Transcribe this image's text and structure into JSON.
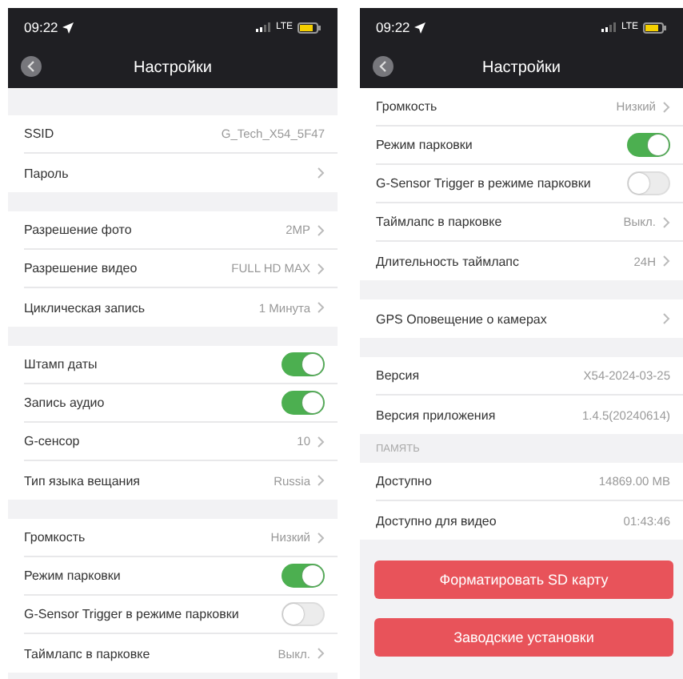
{
  "screens": [
    {
      "status": {
        "time": "09:22",
        "network": "LTE"
      },
      "title": "Настройки",
      "top_gap": true,
      "sections": [
        {
          "rows": [
            {
              "kind": "value",
              "label": "SSID",
              "value": "G_Tech_X54_5F47",
              "chevron": false
            },
            {
              "kind": "value",
              "label": "Пароль",
              "chevron": true
            }
          ]
        },
        {
          "rows": [
            {
              "kind": "value",
              "label": "Разрешение фото",
              "value": "2MP",
              "chevron": true
            },
            {
              "kind": "value",
              "label": "Разрешение видео",
              "value": "FULL HD MAX",
              "chevron": true
            },
            {
              "kind": "value",
              "label": "Циклическая запись",
              "value": "1 Минута",
              "chevron": true
            }
          ]
        },
        {
          "rows": [
            {
              "kind": "toggle",
              "label": "Штамп даты",
              "on": true
            },
            {
              "kind": "toggle",
              "label": "Запись аудио",
              "on": true
            },
            {
              "kind": "value",
              "label": "G-сенсор",
              "value": "10",
              "chevron": true
            },
            {
              "kind": "value",
              "label": "Тип языка вещания",
              "value": "Russia",
              "chevron": true
            }
          ]
        },
        {
          "rows": [
            {
              "kind": "value",
              "label": "Громкость",
              "value": "Низкий",
              "chevron": true
            },
            {
              "kind": "toggle",
              "label": "Режим парковки",
              "on": true
            },
            {
              "kind": "toggle",
              "label": "G-Sensor Trigger в режиме парковки",
              "on": false
            },
            {
              "kind": "value",
              "label": "Таймлапс в парковке",
              "value": "Выкл.",
              "chevron": true
            }
          ]
        }
      ]
    },
    {
      "status": {
        "time": "09:22",
        "network": "LTE"
      },
      "title": "Настройки",
      "top_gap": false,
      "sections": [
        {
          "rows": [
            {
              "kind": "value",
              "label": "Громкость",
              "value": "Низкий",
              "chevron": true
            },
            {
              "kind": "toggle",
              "label": "Режим парковки",
              "on": true
            },
            {
              "kind": "toggle",
              "label": "G-Sensor Trigger в режиме парковки",
              "on": false
            },
            {
              "kind": "value",
              "label": "Таймлапс в парковке",
              "value": "Выкл.",
              "chevron": true
            },
            {
              "kind": "value",
              "label": "Длительность таймлапс",
              "value": "24H",
              "chevron": true
            }
          ]
        },
        {
          "rows": [
            {
              "kind": "value",
              "label": "GPS Оповещение о камерах",
              "chevron": true
            }
          ]
        },
        {
          "rows": [
            {
              "kind": "value",
              "label": "Версия",
              "value": "X54-2024-03-25",
              "chevron": false
            },
            {
              "kind": "value",
              "label": "Версия приложения",
              "value": "1.4.5(20240614)",
              "chevron": false
            }
          ]
        },
        {
          "header": "ПАМЯТЬ",
          "rows": [
            {
              "kind": "value",
              "label": "Доступно",
              "value": "14869.00 MB",
              "chevron": false
            },
            {
              "kind": "value",
              "label": "Доступно для видео",
              "value": "01:43:46",
              "chevron": false
            }
          ]
        }
      ],
      "buttons": [
        "Форматировать SD карту",
        "Заводские установки"
      ]
    }
  ]
}
